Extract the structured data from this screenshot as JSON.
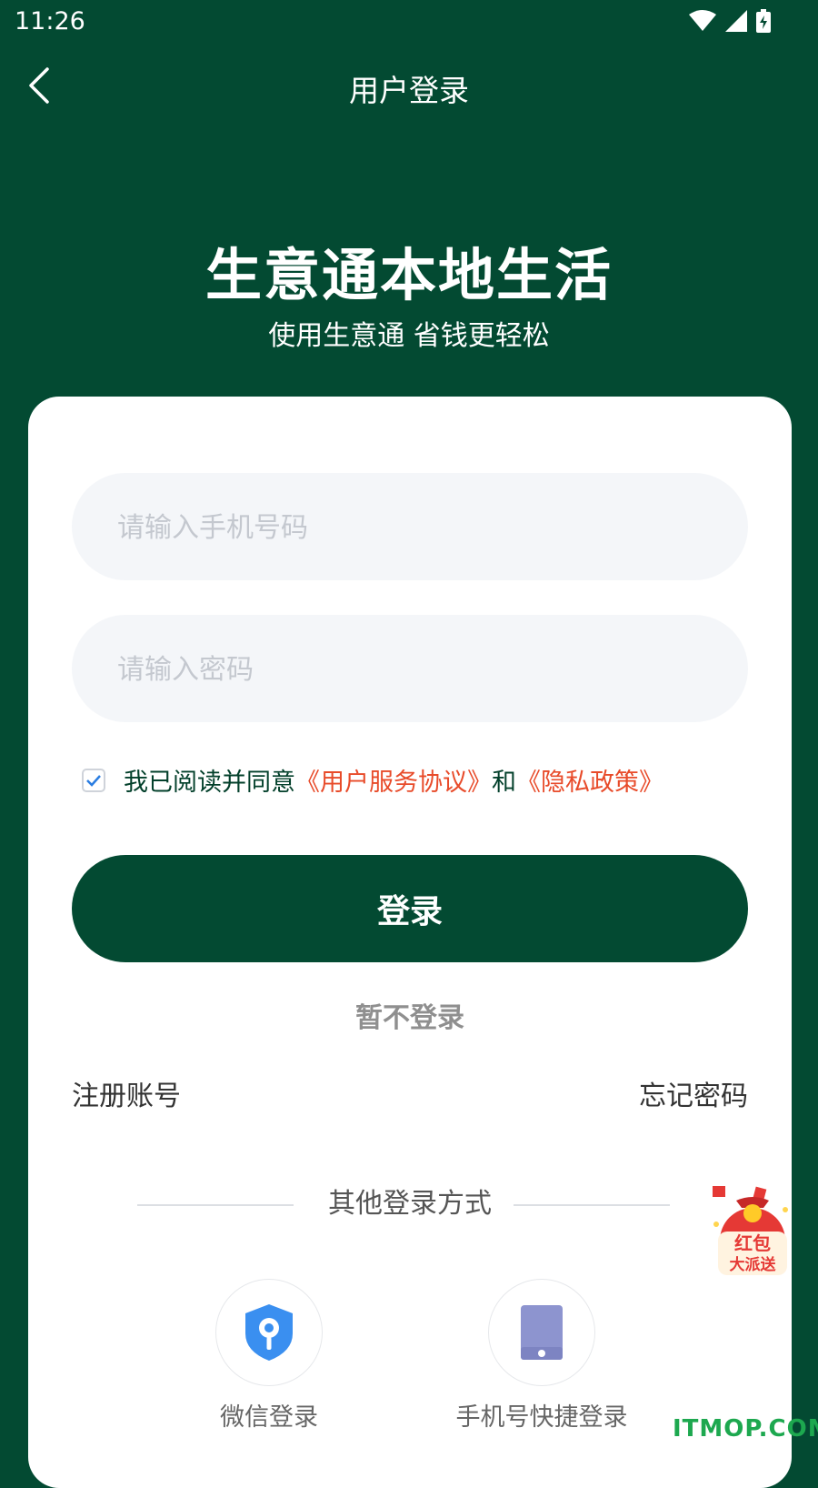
{
  "status_bar": {
    "time": "11:26"
  },
  "nav": {
    "title": "用户登录"
  },
  "hero": {
    "title": "生意通本地生活",
    "subtitle": "使用生意通 省钱更轻松"
  },
  "form": {
    "phone_placeholder": "请输入手机号码",
    "phone_value": "",
    "password_placeholder": "请输入密码",
    "password_value": "",
    "agreement": {
      "checked": true,
      "prefix": "我已阅读并同意",
      "terms_link": "《用户服务协议》",
      "conjunction": "和",
      "privacy_link": "《隐私政策》"
    },
    "login_label": "登录",
    "skip_label": "暂不登录",
    "register_label": "注册账号",
    "forgot_label": "忘记密码"
  },
  "other_login": {
    "title": "其他登录方式",
    "options": [
      {
        "label": "微信登录",
        "icon": "shield-key-icon"
      },
      {
        "label": "手机号快捷登录",
        "icon": "phone-icon"
      }
    ]
  },
  "promo": {
    "label_line1": "红包",
    "label_line2": "大派送"
  },
  "watermark": "ITMOP.COM",
  "colors": {
    "primary": "#034a32",
    "link": "#e84b2a",
    "field_bg": "#f4f6f9",
    "icon_blue": "#3a8ff0",
    "icon_lavender": "#8d94cf"
  }
}
